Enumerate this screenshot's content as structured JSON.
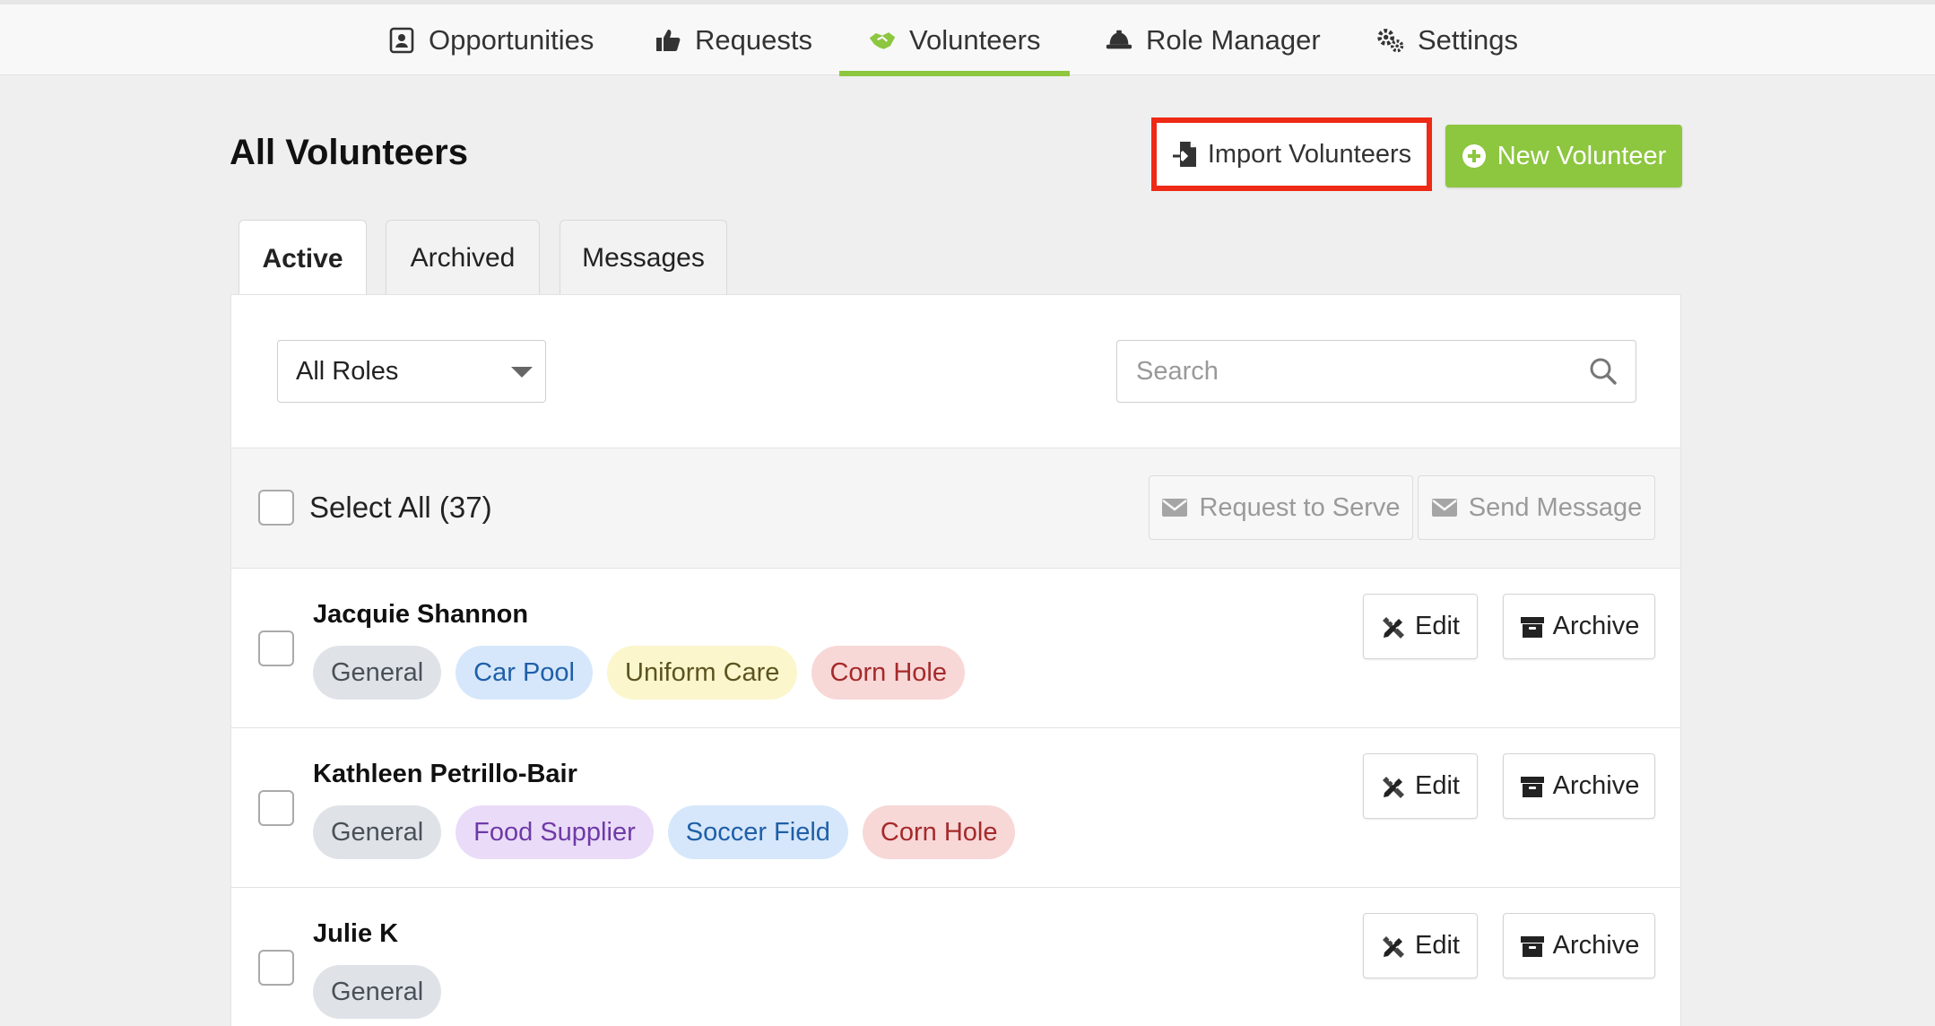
{
  "nav": {
    "items": [
      {
        "label": "Opportunities",
        "icon": "contact-card-icon"
      },
      {
        "label": "Requests",
        "icon": "thumbs-up-icon"
      },
      {
        "label": "Volunteers",
        "icon": "handshake-icon",
        "active": true
      },
      {
        "label": "Role Manager",
        "icon": "hard-hat-icon"
      },
      {
        "label": "Settings",
        "icon": "gears-icon"
      }
    ],
    "active_color": "#8dc63f"
  },
  "header": {
    "title": "All Volunteers",
    "import_label": "Import Volunteers",
    "new_label": "New Volunteer",
    "highlight_color": "#ee2a16",
    "accent_color": "#8dc63f"
  },
  "tabs": [
    {
      "label": "Active",
      "active": true
    },
    {
      "label": "Archived"
    },
    {
      "label": "Messages"
    }
  ],
  "filters": {
    "roles_value": "All Roles",
    "search_placeholder": "Search"
  },
  "bulk": {
    "select_all_label": "Select All (37)",
    "request_label": "Request to Serve",
    "message_label": "Send Message"
  },
  "row_actions": {
    "edit_label": "Edit",
    "archive_label": "Archive"
  },
  "volunteers": [
    {
      "name": "Jacquie Shannon",
      "roles": [
        "General",
        "Car Pool",
        "Uniform Care",
        "Corn Hole"
      ]
    },
    {
      "name": "Kathleen Petrillo-Bair",
      "roles": [
        "General",
        "Food Supplier",
        "Soccer Field",
        "Corn Hole"
      ]
    },
    {
      "name": "Julie K",
      "roles": [
        "General"
      ]
    }
  ],
  "role_colors": {
    "General": {
      "bg": "#dfe3e8",
      "fg": "#495057"
    },
    "Car Pool": {
      "bg": "#d6e7fb",
      "fg": "#1f5fa8"
    },
    "Uniform Care": {
      "bg": "#fbf6cc",
      "fg": "#5c5420"
    },
    "Corn Hole": {
      "bg": "#f8d7d7",
      "fg": "#a52a2a"
    },
    "Food Supplier": {
      "bg": "#eadcf8",
      "fg": "#6f3aa6"
    },
    "Soccer Field": {
      "bg": "#d6e7fb",
      "fg": "#1f5fa8"
    }
  }
}
